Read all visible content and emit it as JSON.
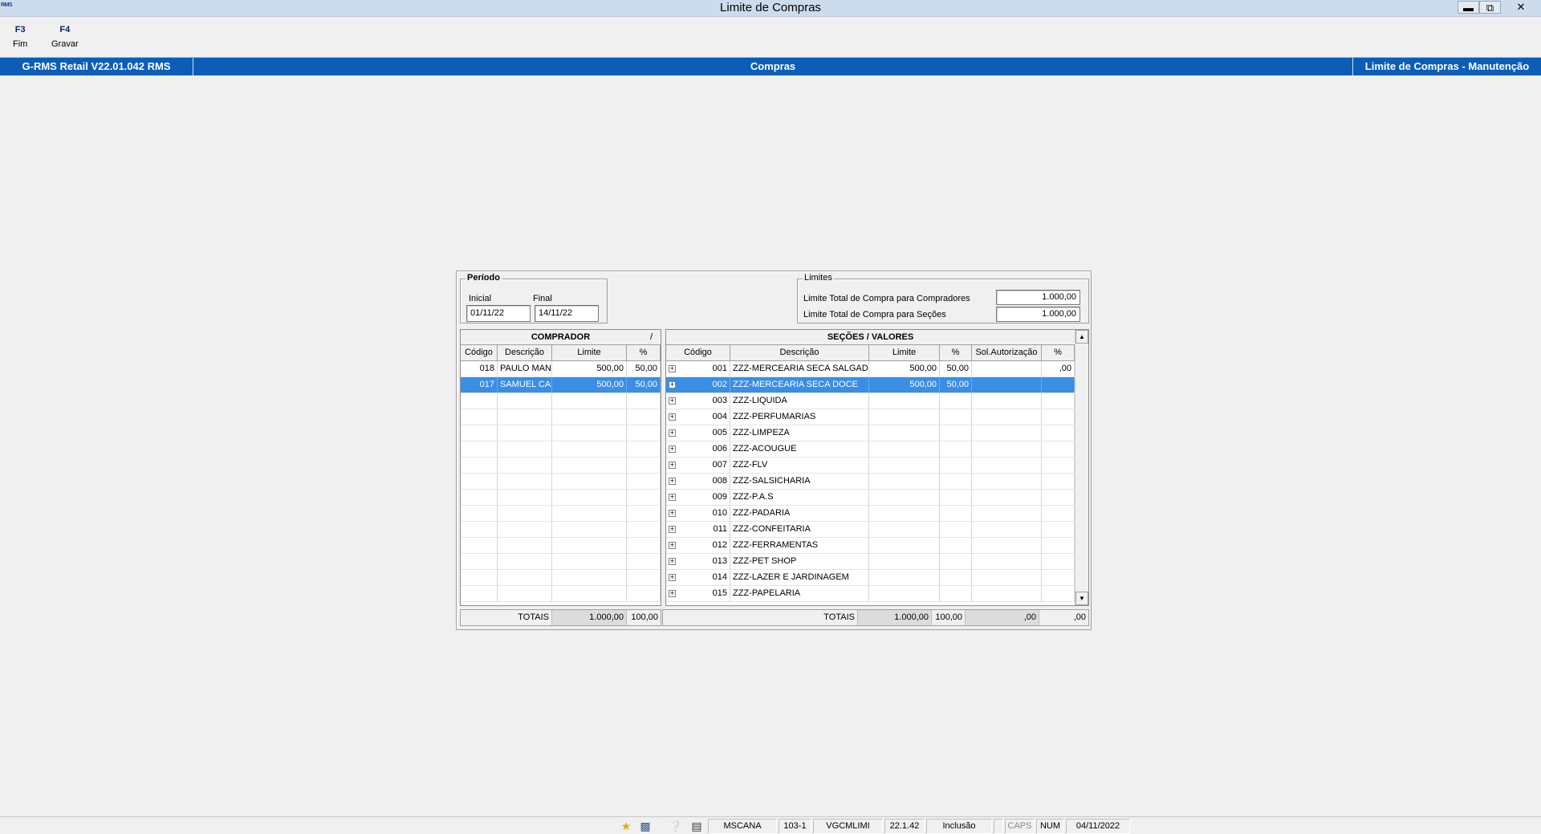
{
  "window": {
    "title": "Limite de Compras",
    "app_icon_text": "RMS",
    "min_icon": "minimize-icon",
    "max_icon": "restore-icon",
    "close_icon": "close-icon"
  },
  "toolbar": {
    "keys": [
      {
        "key": "F3",
        "label": "Fim"
      },
      {
        "key": "F4",
        "label": "Gravar"
      }
    ]
  },
  "header": {
    "left": "G-RMS Retail V22.01.042 RMS",
    "center": "Compras",
    "right": "Limite de Compras - Manutenção"
  },
  "periodo": {
    "legend": "Período",
    "inicial_label": "Inicial",
    "inicial_value": "01/11/22",
    "final_label": "Final",
    "final_value": "14/11/22"
  },
  "limites": {
    "legend": "Limites",
    "compradores_label": "Limite Total de Compra para Compradores",
    "compradores_value": "1.000,00",
    "secoes_label": "Limite Total de Compra para Seções",
    "secoes_value": "1.000,00"
  },
  "comprador_grid": {
    "caption": "COMPRADOR",
    "caption_mark": "/",
    "columns": [
      "Código",
      "Descrição",
      "Limite",
      "%"
    ],
    "rows": [
      {
        "codigo": "018",
        "descricao": "PAULO MAN",
        "limite": "500,00",
        "pct": "50,00",
        "selected": false
      },
      {
        "codigo": "017",
        "descricao": "SAMUEL CA",
        "limite": "500,00",
        "pct": "50,00",
        "selected": true
      }
    ],
    "empty_rows": 13,
    "totals": {
      "label": "TOTAIS",
      "limite": "1.000,00",
      "pct": "100,00"
    }
  },
  "secoes_grid": {
    "caption": "SEÇÕES / VALORES",
    "columns": [
      "Código",
      "Descrição",
      "Limite",
      "%",
      "Sol.Autorização",
      "%"
    ],
    "rows": [
      {
        "codigo": "001",
        "descricao": "ZZZ-MERCEARIA SECA SALGADA",
        "limite": "500,00",
        "pct": "50,00",
        "sol": "",
        "pct2": ",00",
        "selected": false
      },
      {
        "codigo": "002",
        "descricao": "ZZZ-MERCEARIA SECA DOCE",
        "limite": "500,00",
        "pct": "50,00",
        "sol": "",
        "pct2": "",
        "selected": true
      },
      {
        "codigo": "003",
        "descricao": "ZZZ-LIQUIDA",
        "limite": "",
        "pct": "",
        "sol": "",
        "pct2": "",
        "selected": false
      },
      {
        "codigo": "004",
        "descricao": "ZZZ-PERFUMARIAS",
        "limite": "",
        "pct": "",
        "sol": "",
        "pct2": "",
        "selected": false
      },
      {
        "codigo": "005",
        "descricao": "ZZZ-LIMPEZA",
        "limite": "",
        "pct": "",
        "sol": "",
        "pct2": "",
        "selected": false
      },
      {
        "codigo": "006",
        "descricao": "ZZZ-ACOUGUE",
        "limite": "",
        "pct": "",
        "sol": "",
        "pct2": "",
        "selected": false
      },
      {
        "codigo": "007",
        "descricao": "ZZZ-FLV",
        "limite": "",
        "pct": "",
        "sol": "",
        "pct2": "",
        "selected": false
      },
      {
        "codigo": "008",
        "descricao": "ZZZ-SALSICHARIA",
        "limite": "",
        "pct": "",
        "sol": "",
        "pct2": "",
        "selected": false
      },
      {
        "codigo": "009",
        "descricao": "ZZZ-P.A.S",
        "limite": "",
        "pct": "",
        "sol": "",
        "pct2": "",
        "selected": false
      },
      {
        "codigo": "010",
        "descricao": "ZZZ-PADARIA",
        "limite": "",
        "pct": "",
        "sol": "",
        "pct2": "",
        "selected": false
      },
      {
        "codigo": "011",
        "descricao": "ZZZ-CONFEITARIA",
        "limite": "",
        "pct": "",
        "sol": "",
        "pct2": "",
        "selected": false
      },
      {
        "codigo": "012",
        "descricao": "ZZZ-FERRAMENTAS",
        "limite": "",
        "pct": "",
        "sol": "",
        "pct2": "",
        "selected": false
      },
      {
        "codigo": "013",
        "descricao": "ZZZ-PET SHOP",
        "limite": "",
        "pct": "",
        "sol": "",
        "pct2": "",
        "selected": false
      },
      {
        "codigo": "014",
        "descricao": "ZZZ-LAZER E JARDINAGEM",
        "limite": "",
        "pct": "",
        "sol": "",
        "pct2": "",
        "selected": false
      },
      {
        "codigo": "015",
        "descricao": "ZZZ-PAPELARIA",
        "limite": "",
        "pct": "",
        "sol": "",
        "pct2": "",
        "selected": false
      }
    ],
    "totals": {
      "label": "TOTAIS",
      "limite": "1.000,00",
      "pct": "100,00",
      "sol": ",00",
      "pct2": ",00"
    }
  },
  "statusbar": {
    "icons": [
      "star-icon",
      "user-card-icon",
      "help-icon",
      "clipboard-icon"
    ],
    "user": "MSCANA",
    "code": "103-1",
    "program": "VGCMLIMI",
    "version": "22.1.42",
    "mode": "Inclusão",
    "caps": "CAPS",
    "num": "NUM",
    "date": "04/11/2022"
  }
}
